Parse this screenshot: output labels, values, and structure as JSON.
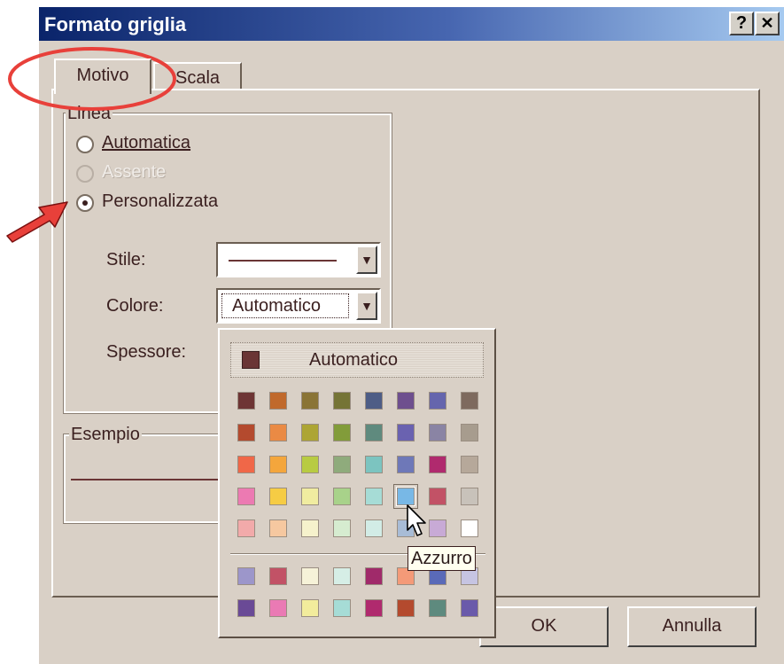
{
  "window": {
    "title": "Formato griglia",
    "help_label": "?",
    "close_label": "✕"
  },
  "tabs": [
    {
      "label": "Motivo"
    },
    {
      "label": "Scala"
    }
  ],
  "linea": {
    "legend": "Linea",
    "options": [
      {
        "label": "Automatica",
        "selected": false,
        "enabled": true
      },
      {
        "label": "Assente",
        "selected": false,
        "enabled": false
      },
      {
        "label": "Personalizzata",
        "selected": true,
        "enabled": true
      }
    ],
    "stile_label": "Stile:",
    "colore_label": "Colore:",
    "colore_value": "Automatico",
    "spessore_label": "Spessore:"
  },
  "esempio": {
    "legend": "Esempio"
  },
  "palette": {
    "automatic_label": "Automatico",
    "automatic_color": "#6a3535",
    "colors": [
      [
        "#6e3535",
        "#c0692c",
        "#8a7436",
        "#757436",
        "#4e5d86",
        "#6e4f8e",
        "#6565ad",
        "#7e6a5e"
      ],
      [
        "#b44a2e",
        "#ea8a44",
        "#ada534",
        "#829c3a",
        "#5f8a7e",
        "#6a62b0",
        "#8a84a4",
        "#a79c8e"
      ],
      [
        "#f06748",
        "#f4a63c",
        "#b8cb42",
        "#8fab7c",
        "#7cc4c0",
        "#6e78b8",
        "#b02a6e",
        "#b6a89a"
      ],
      [
        "#ec7ab2",
        "#f6cc44",
        "#f0eca0",
        "#a8d28a",
        "#a6dcd6",
        "#78b8e6",
        "#c25266",
        "#c8c2ba"
      ],
      [
        "#f2aaaa",
        "#f6c8a0",
        "#f6f2cc",
        "#d6ecd0",
        "#d2ece6",
        "#a8bcd6",
        "#c8aad6",
        "#ffffff"
      ],
      [
        "#9c96ca",
        "#c25266",
        "#f6f2d8",
        "#d6eee6",
        "#a02a6a",
        "#f49a78",
        "#5a6ab8",
        "#c6c4e2"
      ],
      [
        "#6a4a96",
        "#ea7ab4",
        "#f2ec9c",
        "#a6dcd6",
        "#b02a6e",
        "#b44a2e",
        "#5e8a7e",
        "#6a5aaa"
      ]
    ],
    "tooltip": "Azzurro"
  },
  "buttons": {
    "ok": "OK",
    "cancel": "Annulla"
  },
  "annotations": {
    "circle_color": "#e8403a",
    "arrow_color": "#e8403a"
  }
}
